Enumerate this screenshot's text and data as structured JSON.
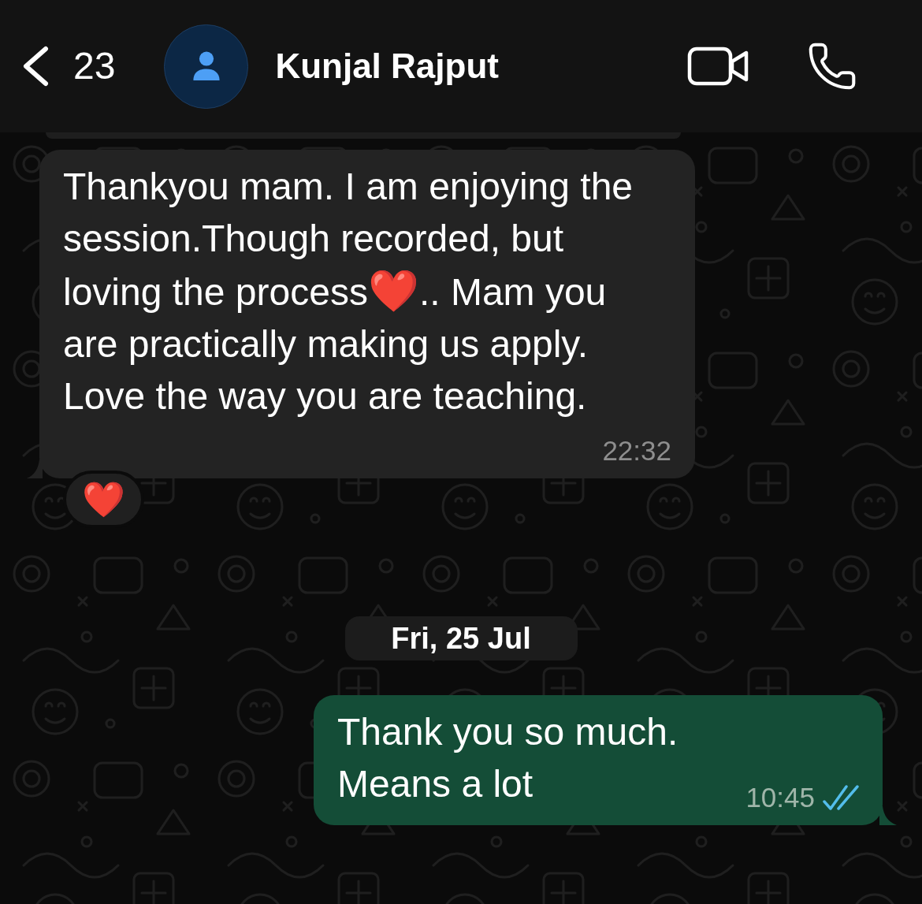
{
  "header": {
    "back_count": "23",
    "contact_name": "Kunjal Rajput"
  },
  "chat": {
    "items": [
      {
        "kind": "cut_off"
      },
      {
        "kind": "incoming",
        "parts": [
          {
            "kind": "text",
            "text": "Thankyou mam. I am enjoying the session.Though recorded, but loving the process"
          },
          {
            "kind": "emoji",
            "text": "❤️"
          },
          {
            "kind": "text",
            "text": ".. Mam you are practically making us apply. Love the way you are teaching."
          }
        ],
        "time": "22:32",
        "reactions": [
          {
            "emoji": "❤️"
          }
        ]
      },
      {
        "kind": "date",
        "text": "Fri, 25 Jul"
      },
      {
        "kind": "outgoing",
        "parts": [
          {
            "kind": "text",
            "text": "Thank you so much.\nMeans a lot"
          }
        ],
        "time": "10:45",
        "read": true
      }
    ]
  }
}
